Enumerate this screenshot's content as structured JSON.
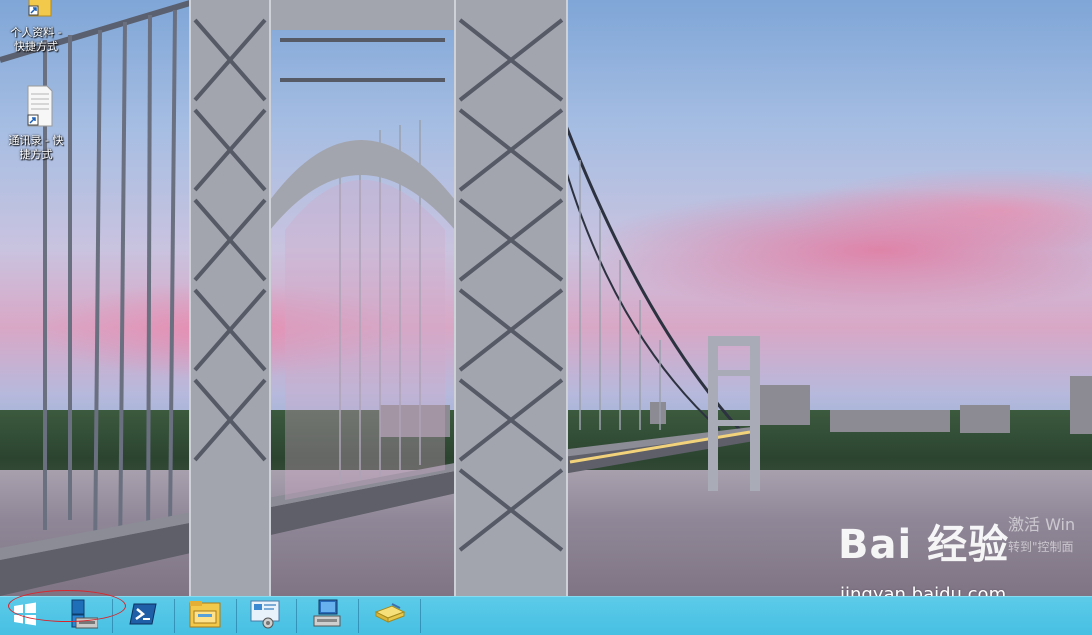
{
  "desktop": {
    "icons": [
      {
        "label_line1": "个人资料 -",
        "label_line2": "快捷方式",
        "icon": "folder-shortcut-icon"
      },
      {
        "label_line1": "通讯录 - 快",
        "label_line2": "捷方式",
        "icon": "document-shortcut-icon"
      }
    ],
    "activation_text": "激活 Win",
    "activation_sub": "转到\"控制面",
    "watermark_logo": "Bai 经验",
    "watermark_url": "jingyan.baidu.com"
  },
  "taskbar": {
    "buttons": [
      {
        "name": "start-button",
        "icon": "windows-logo-icon"
      },
      {
        "name": "server-manager-button",
        "icon": "server-manager-icon"
      },
      {
        "name": "powershell-button",
        "icon": "powershell-icon"
      },
      {
        "name": "file-explorer-button",
        "icon": "folder-icon"
      },
      {
        "name": "control-panel-button",
        "icon": "control-panel-icon"
      },
      {
        "name": "computer-button",
        "icon": "computer-icon"
      },
      {
        "name": "notes-button",
        "icon": "notepad-icon"
      }
    ]
  }
}
